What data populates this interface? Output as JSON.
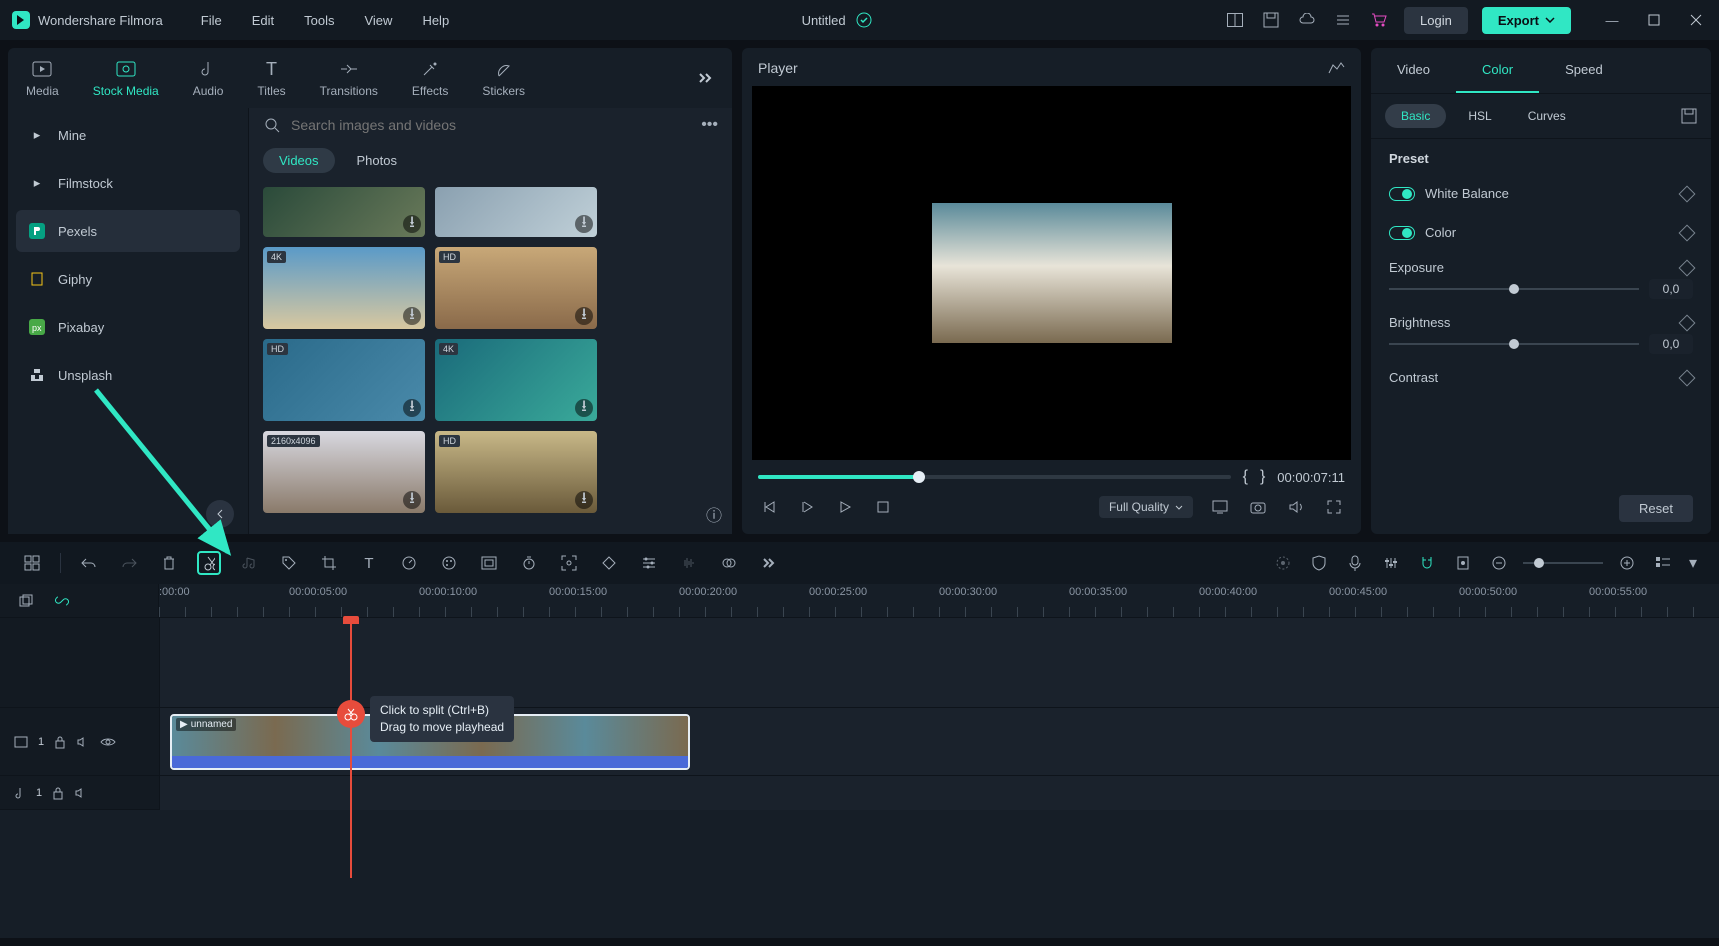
{
  "app_name": "Wondershare Filmora",
  "menus": [
    "File",
    "Edit",
    "Tools",
    "View",
    "Help"
  ],
  "project_title": "Untitled",
  "login_label": "Login",
  "export_label": "Export",
  "asset_tabs": [
    "Media",
    "Stock Media",
    "Audio",
    "Titles",
    "Transitions",
    "Effects",
    "Stickers"
  ],
  "active_asset_tab": "Stock Media",
  "sources": {
    "mine": "Mine",
    "filmstock": "Filmstock",
    "pexels": "Pexels",
    "giphy": "Giphy",
    "pixabay": "Pixabay",
    "unsplash": "Unsplash"
  },
  "search_placeholder": "Search images and videos",
  "media_type_tabs": {
    "videos": "Videos",
    "photos": "Photos"
  },
  "thumbs": [
    {
      "badge": ""
    },
    {
      "badge": ""
    },
    {
      "badge": "4K"
    },
    {
      "badge": "HD"
    },
    {
      "badge": "HD"
    },
    {
      "badge": "4K"
    },
    {
      "badge": "2160x4096"
    },
    {
      "badge": "HD"
    }
  ],
  "player": {
    "title": "Player",
    "cur_time": "00:00:07:11",
    "quality": "Full Quality",
    "marker_open": "{",
    "marker_close": "}"
  },
  "prop_tabs": [
    "Video",
    "Color",
    "Speed"
  ],
  "active_prop_tab": "Color",
  "prop_subtabs": [
    "Basic",
    "HSL",
    "Curves"
  ],
  "active_prop_subtab": "Basic",
  "preset": "Preset",
  "toggles": {
    "wb": "White Balance",
    "color": "Color"
  },
  "controls": {
    "exposure": {
      "label": "Exposure",
      "value": "0,0"
    },
    "brightness": {
      "label": "Brightness",
      "value": "0,0"
    },
    "contrast": {
      "label": "Contrast"
    }
  },
  "reset_label": "Reset",
  "ruler": [
    ":00:00",
    "00:00:05:00",
    "00:00:10:00",
    "00:00:15:00",
    "00:00:20:00",
    "00:00:25:00",
    "00:00:30:00",
    "00:00:35:00",
    "00:00:40:00",
    "00:00:45:00",
    "00:00:50:00",
    "00:00:55:00"
  ],
  "clip_name": "unnamed",
  "tooltip": {
    "l1": "Click to split (Ctrl+B)",
    "l2": "Drag to move playhead"
  },
  "track_video": "1",
  "track_audio": "1"
}
